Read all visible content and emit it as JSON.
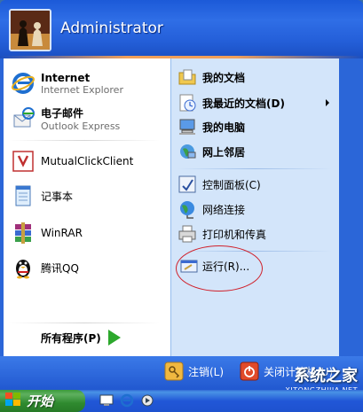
{
  "header": {
    "username": "Administrator"
  },
  "pinned": [
    {
      "title": "Internet",
      "subtitle": "Internet Explorer",
      "icon": "internet-explorer-icon"
    },
    {
      "title": "电子邮件",
      "subtitle": "Outlook Express",
      "icon": "outlook-express-icon"
    }
  ],
  "recent": [
    {
      "label": "MutualClickClient",
      "icon": "mutualclick-icon"
    },
    {
      "label": "记事本",
      "icon": "notepad-icon"
    },
    {
      "label": "WinRAR",
      "icon": "winrar-icon"
    },
    {
      "label": "腾讯QQ",
      "icon": "qq-penguin-icon"
    }
  ],
  "all_programs": "所有程序(P)",
  "places": [
    {
      "label": "我的文档",
      "icon": "my-documents-icon"
    },
    {
      "label": "我最近的文档(D)",
      "icon": "recent-documents-icon"
    },
    {
      "label": "我的电脑",
      "icon": "my-computer-icon"
    },
    {
      "label": "网上邻居",
      "icon": "network-places-icon"
    }
  ],
  "system": [
    {
      "label": "控制面板(C)",
      "icon": "control-panel-icon"
    },
    {
      "label": "网络连接",
      "icon": "network-connections-icon"
    },
    {
      "label": "打印机和传真",
      "icon": "printer-icon"
    }
  ],
  "run": {
    "label": "运行(R)...",
    "icon": "run-icon"
  },
  "footer": {
    "logoff": "注销(L)",
    "shutdown": "关闭计算机(U)"
  },
  "taskbar": {
    "start": "开始"
  },
  "watermark": {
    "main": "系统之家",
    "sub": "XITONGZHIJIA.NET"
  },
  "colors": {
    "header_blue": "#245fd9",
    "right_pane": "#d3e5fa",
    "start_green": "#2f8a2f",
    "highlight_circle": "#d0202a"
  }
}
